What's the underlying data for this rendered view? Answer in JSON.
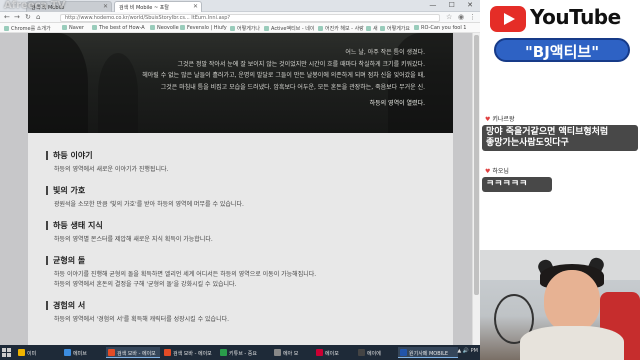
{
  "watermark": "Afreeca TV",
  "browser": {
    "tabs": [
      {
        "label": "검색 비 Mobile"
      },
      {
        "label": "검색 비 Mobile ~ 포탈"
      }
    ],
    "window_controls": "— ☐ ✕",
    "url": "http://www.hodemo.co.kr/world/SbuisStoryIbr.cs... ItEurn.Inni.asp?"
  },
  "bookmarks": [
    {
      "label": "Chrome를 소개가"
    },
    {
      "label": "Naver"
    },
    {
      "label": "The best of How-A"
    },
    {
      "label": "Neovolle"
    },
    {
      "label": "Fevenslo | Hiufy"
    },
    {
      "label": "어떻게가나"
    },
    {
      "label": "Active액티브 - 네이"
    },
    {
      "label": "어진카 해보 - 사랑"
    },
    {
      "label": "새"
    },
    {
      "label": "어떻게가요"
    },
    {
      "label": "RO-Can you fool 1"
    }
  ],
  "hero": {
    "lines": [
      "어느 날, 아주 작은 틈이 생겼다.",
      "그것은 정말 작아서 눈에 잘 보이지 않는 것이었지만 시간이 흐를 때마다 착실하게 크기를 키워갔다.",
      "헤아릴 수 없는 많은 날들이 흘러가고, 운명의 발달로 그들이 만든 날봉이에 의존하게 되며 점차 신을 잊어갔을 때,",
      "그것은 마침내 틈을 비집고 모습을 드러냈다. 암흑보다 어두운, 모든 혼돈을 관장하는, 죽음보다 무거운 신.",
      "하등의 영역이 열렸다."
    ]
  },
  "sections": [
    {
      "title": "하등 이야기",
      "lines": [
        "하등의 영역에서 새로운 이야기가 진행됩니다."
      ]
    },
    {
      "title": "빛의 가호",
      "lines": [
        "광원석을 소모한 만큼 '빛의 가호'를 받아 하등의 영역에 머무를 수 있습니다."
      ]
    },
    {
      "title": "하등 생태 지식",
      "lines": [
        "하등의 영역별 몬스터를 제압해 새로운 지식 획득이 가능합니다."
      ]
    },
    {
      "title": "균형의 돌",
      "lines": [
        "하등 이야기를 진행해 균형의 돌을 획득하면 엘리언 세계 어디서든 하등의 영역으로 이동이 가능해집니다.",
        "하등의 영역에서 혼돈의 결정을 구해 '균형의 돌'을 강화시킬 수 있습니다."
      ]
    },
    {
      "title": "경험의 서",
      "lines": [
        "하등의 영역에서 '경험의 서'를 획득해 캐릭터를 성장시킬 수 있습니다."
      ]
    }
  ],
  "stream": {
    "yt_text": "YouTube",
    "bj_title": "\"BJ액티브\""
  },
  "chat": [
    {
      "name": "키나르왕",
      "message_lines": [
        "망야 죽을거같으면 액티브형처럼",
        "좋망가는사람도잇다구"
      ]
    },
    {
      "name": "하오님",
      "message_lines": [
        "ㅋㅋㅋㅋㅋ"
      ]
    }
  ],
  "taskbar": {
    "items": [
      {
        "label": "이미",
        "color": "#f0b400"
      },
      {
        "label": "에미브",
        "color": "#3c8de0"
      },
      {
        "label": "검색 모바 - 에이모",
        "color": "#e34c26"
      },
      {
        "label": "검색 모바 - 에이모",
        "color": "#e34c26"
      },
      {
        "label": "키튜브 - 중요",
        "color": "#2a9d4b"
      },
      {
        "label": "에아 모",
        "color": "#888"
      },
      {
        "label": "에이모",
        "color": "#c03"
      },
      {
        "label": "에이에",
        "color": "#444"
      },
      {
        "label": "원기사페 MOBILE",
        "color": "#25a"
      }
    ],
    "tray": "▲ 🔊 PM"
  }
}
